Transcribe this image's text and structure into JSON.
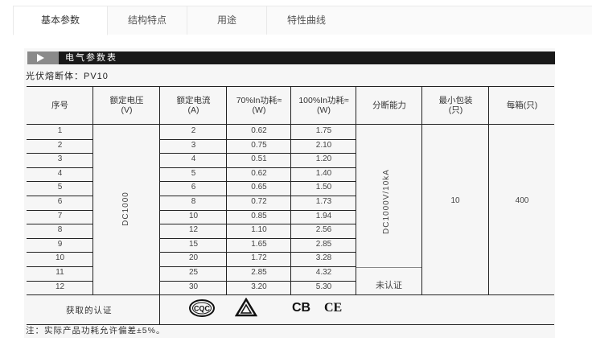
{
  "tabs": [
    {
      "label": "基本参数",
      "active": true
    },
    {
      "label": "结构特点",
      "active": false
    },
    {
      "label": "用途",
      "active": false
    },
    {
      "label": "特性曲线",
      "active": false
    }
  ],
  "section": {
    "title": "电气参数表",
    "subtitle": "光伏熔断体：PV10"
  },
  "table": {
    "headers": [
      [
        "序号"
      ],
      [
        "额定电压",
        "(V)"
      ],
      [
        "额定电流",
        "(A)"
      ],
      [
        "70%In功耗≈",
        "(W)"
      ],
      [
        "100%In功耗≈",
        "(W)"
      ],
      [
        "分断能力"
      ],
      [
        "最小包装",
        "(只)"
      ],
      [
        "每箱(只)"
      ]
    ],
    "voltage": "DC1000",
    "breaking_capacity": "DC1000V/10kA",
    "breaking_capacity_uncertified": "未认证",
    "min_pack": "10",
    "per_box": "400",
    "rows": [
      {
        "no": "1",
        "current": "2",
        "p70": "0.62",
        "p100": "1.75"
      },
      {
        "no": "2",
        "current": "3",
        "p70": "0.75",
        "p100": "2.10"
      },
      {
        "no": "3",
        "current": "4",
        "p70": "0.51",
        "p100": "1.20"
      },
      {
        "no": "4",
        "current": "5",
        "p70": "0.62",
        "p100": "1.40"
      },
      {
        "no": "5",
        "current": "6",
        "p70": "0.65",
        "p100": "1.50"
      },
      {
        "no": "6",
        "current": "8",
        "p70": "0.72",
        "p100": "1.73"
      },
      {
        "no": "7",
        "current": "10",
        "p70": "0.85",
        "p100": "1.94"
      },
      {
        "no": "8",
        "current": "12",
        "p70": "1.10",
        "p100": "2.56"
      },
      {
        "no": "9",
        "current": "15",
        "p70": "1.65",
        "p100": "2.85"
      },
      {
        "no": "10",
        "current": "20",
        "p70": "1.72",
        "p100": "3.28"
      },
      {
        "no": "11",
        "current": "25",
        "p70": "2.85",
        "p100": "4.32"
      },
      {
        "no": "12",
        "current": "30",
        "p70": "3.20",
        "p100": "5.30"
      }
    ]
  },
  "certifications": {
    "label": "获取的认证",
    "marks": [
      "CQC",
      "TÜV",
      "CB",
      "CE"
    ]
  },
  "note": "注：实际产品功耗允许偏差±5%。"
}
